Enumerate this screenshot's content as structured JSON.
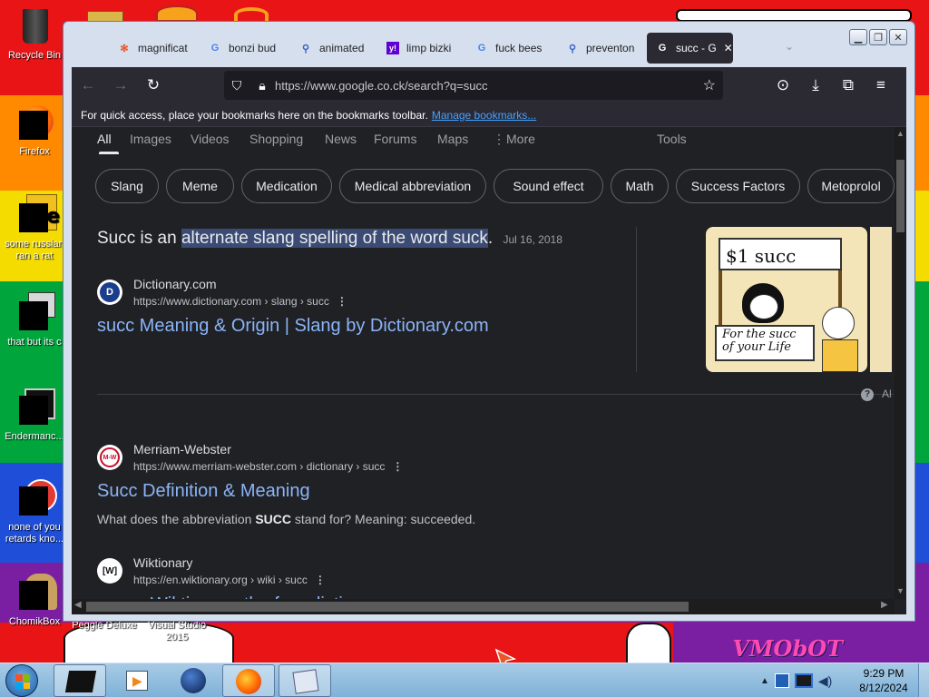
{
  "desktop": {
    "icons": [
      {
        "label": "Recycle Bin"
      },
      {
        "label": "Firefox"
      },
      {
        "label": "some russian ran a rat"
      },
      {
        "label": "that but its c"
      },
      {
        "label": "Endermanc..."
      },
      {
        "label": "none of you retards kno..."
      },
      {
        "label": "ChomikBox"
      },
      {
        "label": "Peggle Deluxe"
      },
      {
        "label": "Visual Studio 2015"
      }
    ],
    "watermark": "VMObOT"
  },
  "browser": {
    "tabs": [
      {
        "label": "magnificat",
        "icon": "✻",
        "active": false
      },
      {
        "label": "bonzi bud",
        "icon": "G",
        "active": false
      },
      {
        "label": "animated",
        "icon": "🔍",
        "active": false
      },
      {
        "label": "limp bizki",
        "icon": "y!",
        "active": false
      },
      {
        "label": "fuck bees",
        "icon": "G",
        "active": false
      },
      {
        "label": "preventon",
        "icon": "🔍",
        "active": false
      },
      {
        "label": "succ - G",
        "icon": "G",
        "active": true
      }
    ],
    "url": "https://www.google.co.ck/search?q=succ",
    "bookmarks_text": "For quick access, place your bookmarks here on the bookmarks toolbar.",
    "bookmarks_link": "Manage bookmarks..."
  },
  "search": {
    "nav": [
      "All",
      "Images",
      "Videos",
      "Shopping",
      "News",
      "Forums",
      "Maps",
      "More",
      "Tools"
    ],
    "chips": [
      "Slang",
      "Meme",
      "Medication",
      "Medical abbreviation",
      "Sound effect",
      "Math",
      "Success Factors",
      "Metoprolol"
    ],
    "snippet_pre": "Succ is an ",
    "snippet_highlight": "alternate slang spelling of the word suck",
    "snippet_post": ".",
    "snippet_date": "Jul 16, 2018",
    "thumb_text_top": "$1 succ",
    "thumb_text_bottom": "For the succ of your Life",
    "about": "Al",
    "results": [
      {
        "favicon": "D",
        "site": "Dictionary.com",
        "url": "https://www.dictionary.com › slang › succ",
        "title": "succ Meaning & Origin | Slang by Dictionary.com",
        "desc_pre": "",
        "desc_bold": "",
        "desc_post": ""
      },
      {
        "favicon": "M-W",
        "site": "Merriam-Webster",
        "url": "https://www.merriam-webster.com › dictionary › succ",
        "title": "Succ Definition & Meaning",
        "desc_pre": "What does the abbreviation ",
        "desc_bold": "SUCC",
        "desc_post": " stand for? Meaning: succeeded."
      },
      {
        "favicon": "[W]",
        "site": "Wiktionary",
        "url": "https://en.wiktionary.org › wiki › succ",
        "title": "succ - Wiktionary, the free dictionary",
        "desc_pre": "",
        "desc_bold": "",
        "desc_post": ""
      }
    ]
  },
  "taskbar": {
    "time": "9:29 PM",
    "date": "8/12/2024"
  }
}
